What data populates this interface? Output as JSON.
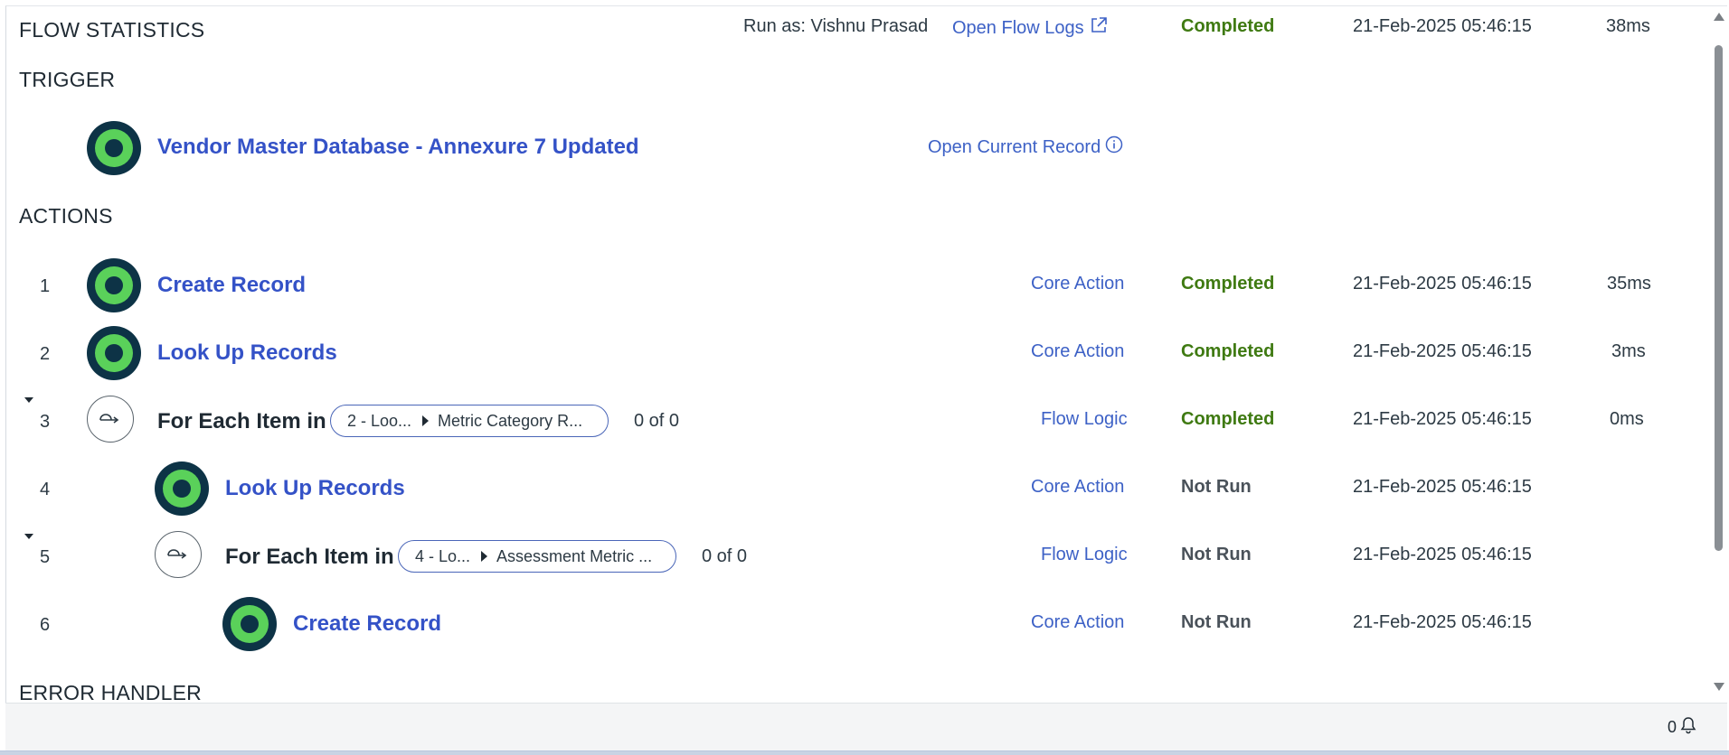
{
  "header": {
    "title": "FLOW STATISTICS",
    "run_as": "Run as: Vishnu Prasad",
    "open_logs": "Open Flow Logs",
    "status": "Completed",
    "timestamp": "21-Feb-2025 05:46:15",
    "duration": "38ms"
  },
  "sections": {
    "trigger": "TRIGGER",
    "actions": "ACTIONS",
    "error_handler": "ERROR HANDLER"
  },
  "trigger": {
    "title": "Vendor Master Database - Annexure 7 Updated",
    "open_record": "Open Current Record"
  },
  "actions": [
    {
      "num": "1",
      "title": "Create Record",
      "type": "Core Action",
      "status": "Completed",
      "time": "21-Feb-2025 05:46:15",
      "duration": "35ms"
    },
    {
      "num": "2",
      "title": "Look Up Records",
      "type": "Core Action",
      "status": "Completed",
      "time": "21-Feb-2025 05:46:15",
      "duration": "3ms"
    },
    {
      "num": "3",
      "title": "For Each Item in",
      "pill_a": "2 - Loo...",
      "pill_b": "Metric Category R...",
      "count": "0 of 0",
      "type": "Flow Logic",
      "status": "Completed",
      "time": "21-Feb-2025 05:46:15",
      "duration": "0ms"
    },
    {
      "num": "4",
      "title": "Look Up Records",
      "type": "Core Action",
      "status": "Not Run",
      "time": "21-Feb-2025 05:46:15",
      "duration": ""
    },
    {
      "num": "5",
      "title": "For Each Item in",
      "pill_a": "4 - Lo...",
      "pill_b": "Assessment Metric ...",
      "count": "0 of 0",
      "type": "Flow Logic",
      "status": "Not Run",
      "time": "21-Feb-2025 05:46:15",
      "duration": ""
    },
    {
      "num": "6",
      "title": "Create Record",
      "type": "Core Action",
      "status": "Not Run",
      "time": "21-Feb-2025 05:46:15",
      "duration": ""
    }
  ],
  "footer": {
    "notification_count": "0"
  },
  "colors": {
    "link": "#3d61c6",
    "completed": "#3f7a12",
    "avatar_ring": "#5ad15a",
    "avatar_dark": "#0d3346"
  }
}
